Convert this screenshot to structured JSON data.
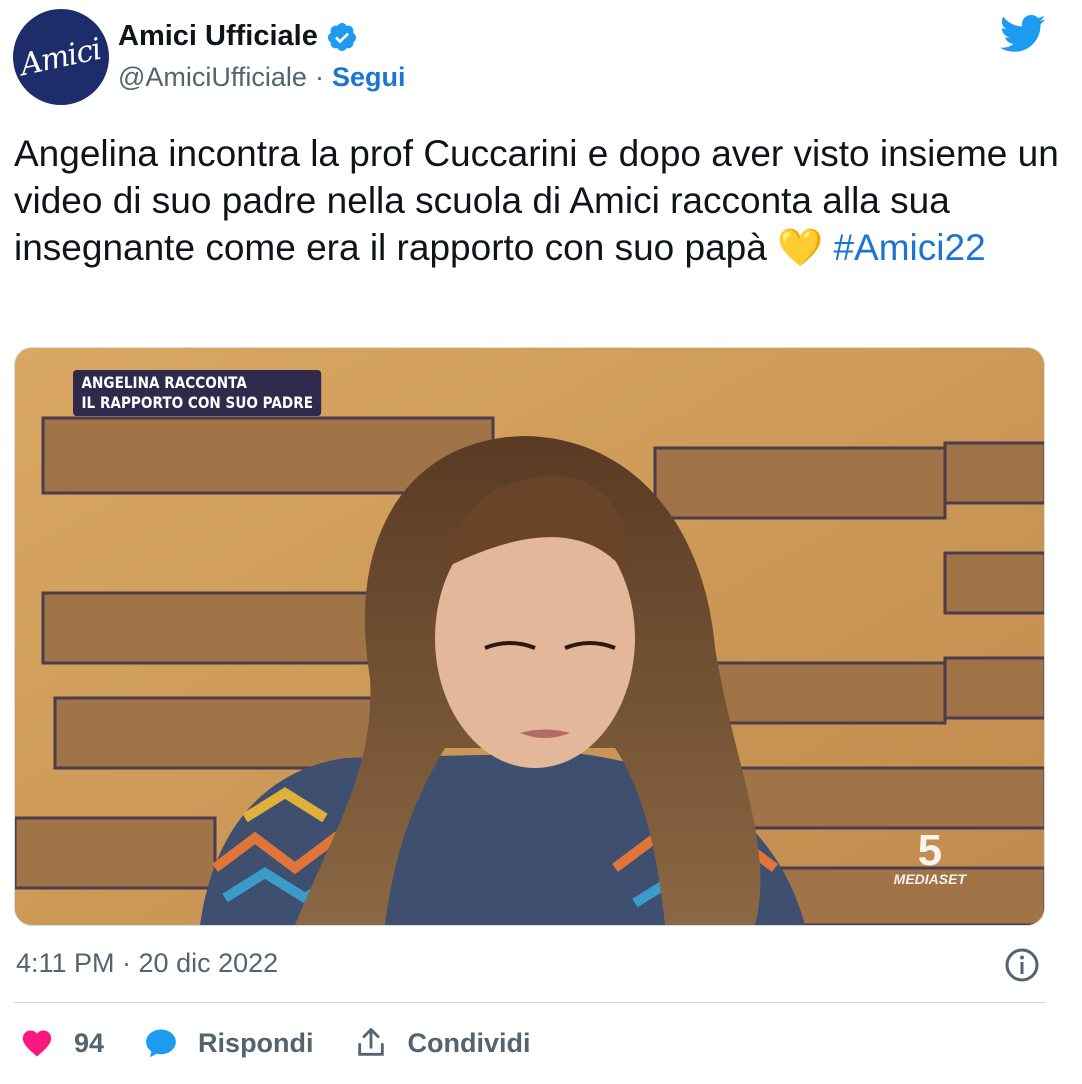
{
  "account": {
    "avatar_text": "Amici",
    "display_name": "Amici Ufficiale",
    "handle": "@AmiciUfficiale",
    "separator": "·",
    "follow_label": "Segui"
  },
  "tweet": {
    "text": "Angelina incontra la prof Cuccarini e dopo aver visto insieme un video di suo padre nella scuola di Amici racconta alla sua insegnante come era il rapporto con suo papà ",
    "emoji": "💛",
    "hashtag": "#Amici22"
  },
  "media": {
    "caption_line1": "ANGELINA RACCONTA",
    "caption_line2": "IL RAPPORTO CON SUO PADRE",
    "channel_number": "5",
    "channel_name": "MEDIASET"
  },
  "meta": {
    "timestamp": "4:11 PM · 20 dic 2022"
  },
  "actions": {
    "likes": "94",
    "reply_label": "Rispondi",
    "share_label": "Condividi"
  },
  "colors": {
    "link_blue": "#1d74d4",
    "twitter_blue": "#1d9bf0",
    "like_pink": "#f91880",
    "avatar_navy": "#1d2d6b"
  },
  "icons": [
    "verified-badge-icon",
    "twitter-bird-icon",
    "info-icon",
    "heart-icon",
    "reply-bubble-icon",
    "share-icon"
  ]
}
